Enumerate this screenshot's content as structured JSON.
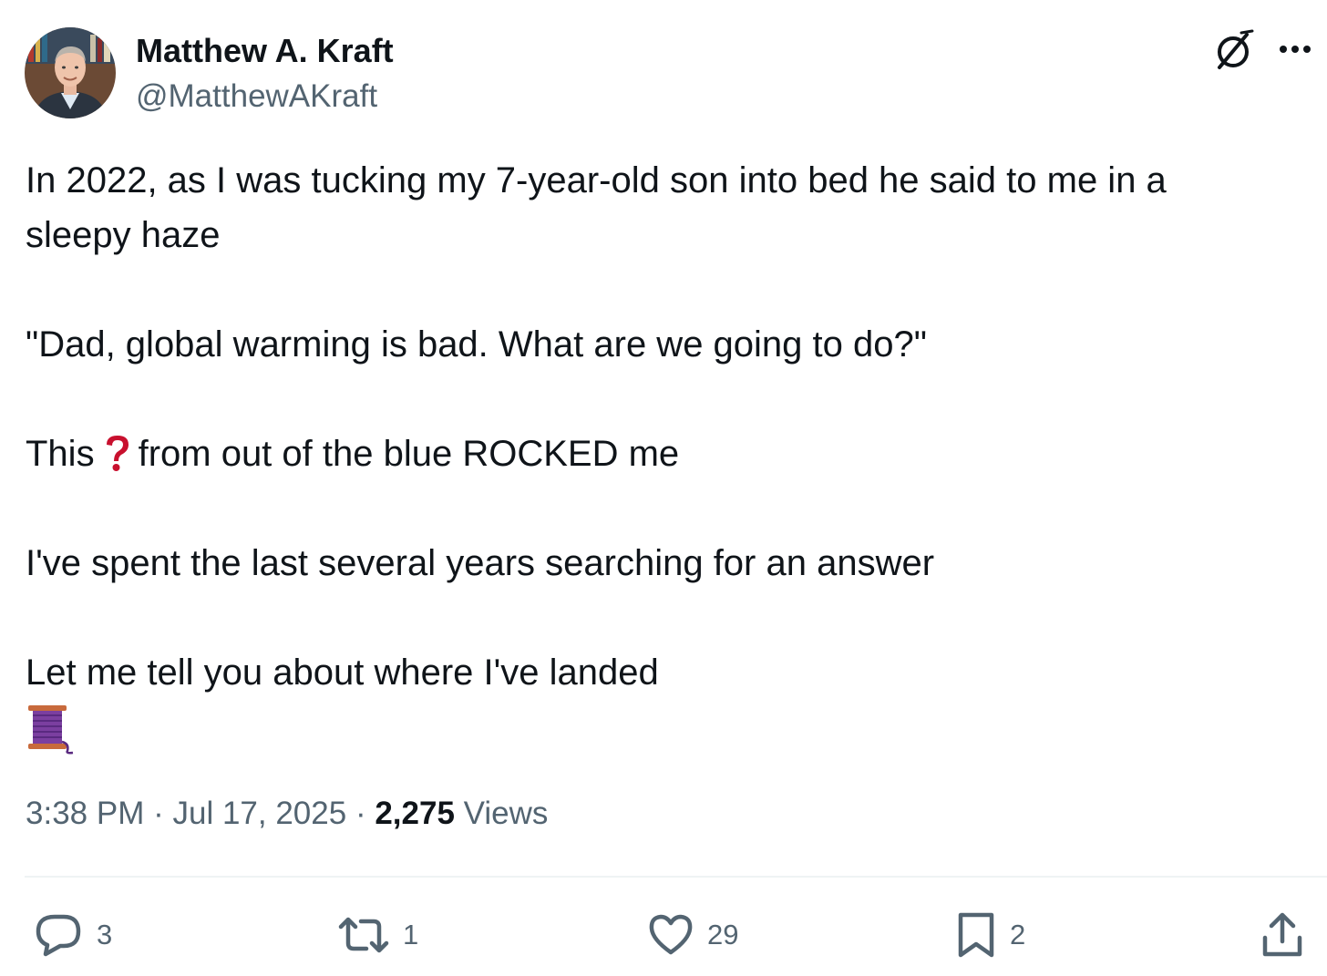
{
  "author": {
    "name": "Matthew A. Kraft",
    "handle": "@MatthewAKraft"
  },
  "tweet": {
    "lines": {
      "l1": "In 2022, as I was tucking my 7-year-old son into bed he said to me in a",
      "l2": "sleepy haze",
      "l3": "\"Dad, global warming is bad. What are we going to do?\"",
      "l4a": "This",
      "l4b": "from out of the blue ROCKED me",
      "l5": "I've spent the last several years searching for an answer",
      "l6": "Let me tell you about where I've landed"
    },
    "emojis": [
      "red-question-mark",
      "thread-spool"
    ]
  },
  "meta": {
    "time": "3:38 PM",
    "separator": "·",
    "date": "Jul 17, 2025",
    "views_count": "2,275",
    "views_label": "Views"
  },
  "actions": {
    "reply_count": "3",
    "retweet_count": "1",
    "like_count": "29",
    "bookmark_count": "2"
  },
  "colors": {
    "text_primary": "#0f1419",
    "text_secondary": "#536471",
    "divider": "#eff3f4",
    "emoji_red": "#c8102e",
    "spool_purple": "#7b3fa0"
  }
}
